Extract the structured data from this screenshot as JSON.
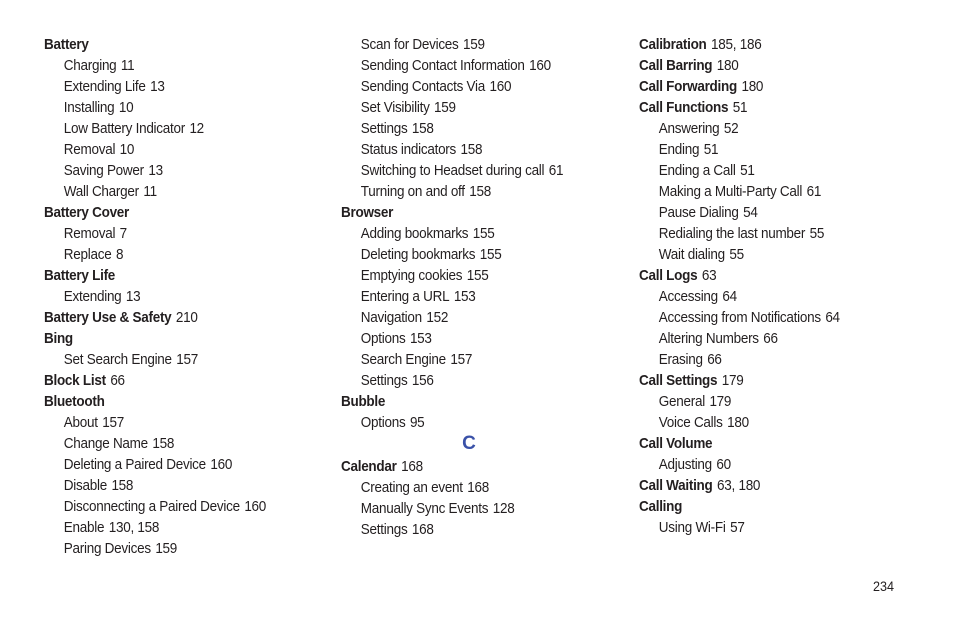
{
  "columns": [
    {
      "entries": [
        {
          "level": "main",
          "term": "Battery",
          "pages": ""
        },
        {
          "level": "sub",
          "term": "Charging",
          "pages": "11"
        },
        {
          "level": "sub",
          "term": "Extending Life",
          "pages": "13"
        },
        {
          "level": "sub",
          "term": "Installing",
          "pages": "10"
        },
        {
          "level": "sub",
          "term": "Low Battery Indicator",
          "pages": "12"
        },
        {
          "level": "sub",
          "term": "Removal",
          "pages": "10"
        },
        {
          "level": "sub",
          "term": "Saving Power",
          "pages": "13"
        },
        {
          "level": "sub",
          "term": "Wall Charger",
          "pages": "11"
        },
        {
          "level": "main",
          "term": "Battery Cover",
          "pages": ""
        },
        {
          "level": "sub",
          "term": "Removal",
          "pages": "7"
        },
        {
          "level": "sub",
          "term": "Replace",
          "pages": "8"
        },
        {
          "level": "main",
          "term": "Battery Life",
          "pages": ""
        },
        {
          "level": "sub",
          "term": "Extending",
          "pages": "13"
        },
        {
          "level": "main",
          "term": "Battery Use & Safety",
          "pages": "210"
        },
        {
          "level": "main",
          "term": "Bing",
          "pages": ""
        },
        {
          "level": "sub",
          "term": "Set Search Engine",
          "pages": "157"
        },
        {
          "level": "main",
          "term": "Block List",
          "pages": "66"
        },
        {
          "level": "main",
          "term": "Bluetooth",
          "pages": ""
        },
        {
          "level": "sub",
          "term": "About",
          "pages": "157"
        },
        {
          "level": "sub",
          "term": "Change Name",
          "pages": "158"
        },
        {
          "level": "sub",
          "term": "Deleting a Paired Device",
          "pages": "160"
        },
        {
          "level": "sub",
          "term": "Disable",
          "pages": "158"
        },
        {
          "level": "sub",
          "term": "Disconnecting a Paired Device",
          "pages": "160"
        },
        {
          "level": "sub",
          "term": "Enable",
          "pages": "130, 158"
        },
        {
          "level": "sub",
          "term": "Paring Devices",
          "pages": "159"
        }
      ]
    },
    {
      "entries": [
        {
          "level": "sub",
          "term": "Scan for Devices",
          "pages": "159"
        },
        {
          "level": "sub",
          "term": "Sending Contact Information",
          "pages": "160"
        },
        {
          "level": "sub",
          "term": "Sending Contacts Via",
          "pages": "160"
        },
        {
          "level": "sub",
          "term": "Set Visibility",
          "pages": "159"
        },
        {
          "level": "sub",
          "term": "Settings",
          "pages": "158"
        },
        {
          "level": "sub",
          "term": "Status indicators",
          "pages": "158"
        },
        {
          "level": "sub",
          "term": "Switching to Headset during call",
          "pages": "61"
        },
        {
          "level": "sub",
          "term": "Turning on and off",
          "pages": "158"
        },
        {
          "level": "main",
          "term": "Browser",
          "pages": ""
        },
        {
          "level": "sub",
          "term": "Adding bookmarks",
          "pages": "155"
        },
        {
          "level": "sub",
          "term": "Deleting bookmarks",
          "pages": "155"
        },
        {
          "level": "sub",
          "term": "Emptying cookies",
          "pages": "155"
        },
        {
          "level": "sub",
          "term": "Entering a URL",
          "pages": "153"
        },
        {
          "level": "sub",
          "term": "Navigation",
          "pages": "152"
        },
        {
          "level": "sub",
          "term": "Options",
          "pages": "153"
        },
        {
          "level": "sub",
          "term": "Search Engine",
          "pages": "157"
        },
        {
          "level": "sub",
          "term": "Settings",
          "pages": "156"
        },
        {
          "level": "main",
          "term": "Bubble",
          "pages": ""
        },
        {
          "level": "sub",
          "term": "Options",
          "pages": "95"
        },
        {
          "level": "letter",
          "term": "C",
          "pages": ""
        },
        {
          "level": "main",
          "term": "Calendar",
          "pages": "168"
        },
        {
          "level": "sub",
          "term": "Creating an event",
          "pages": "168"
        },
        {
          "level": "sub",
          "term": "Manually Sync Events",
          "pages": "128"
        },
        {
          "level": "sub",
          "term": "Settings",
          "pages": "168"
        }
      ]
    },
    {
      "entries": [
        {
          "level": "main",
          "term": "Calibration",
          "pages": "185, 186"
        },
        {
          "level": "main",
          "term": "Call Barring",
          "pages": "180"
        },
        {
          "level": "main",
          "term": "Call Forwarding",
          "pages": "180"
        },
        {
          "level": "main",
          "term": "Call Functions",
          "pages": "51"
        },
        {
          "level": "sub",
          "term": "Answering",
          "pages": "52"
        },
        {
          "level": "sub",
          "term": "Ending",
          "pages": "51"
        },
        {
          "level": "sub",
          "term": "Ending a Call",
          "pages": "51"
        },
        {
          "level": "sub",
          "term": "Making a Multi-Party Call",
          "pages": "61"
        },
        {
          "level": "sub",
          "term": "Pause Dialing",
          "pages": "54"
        },
        {
          "level": "sub",
          "term": "Redialing the last number",
          "pages": "55"
        },
        {
          "level": "sub",
          "term": "Wait dialing",
          "pages": "55"
        },
        {
          "level": "main",
          "term": "Call Logs",
          "pages": "63"
        },
        {
          "level": "sub",
          "term": "Accessing",
          "pages": "64"
        },
        {
          "level": "sub",
          "term": "Accessing from Notifications",
          "pages": "64"
        },
        {
          "level": "sub",
          "term": "Altering Numbers",
          "pages": "66"
        },
        {
          "level": "sub",
          "term": "Erasing",
          "pages": "66"
        },
        {
          "level": "main",
          "term": "Call Settings",
          "pages": "179"
        },
        {
          "level": "sub",
          "term": "General",
          "pages": "179"
        },
        {
          "level": "sub",
          "term": "Voice Calls",
          "pages": "180"
        },
        {
          "level": "main",
          "term": "Call Volume",
          "pages": ""
        },
        {
          "level": "sub",
          "term": "Adjusting",
          "pages": "60"
        },
        {
          "level": "main",
          "term": "Call Waiting",
          "pages": "63, 180"
        },
        {
          "level": "main",
          "term": "Calling",
          "pages": ""
        },
        {
          "level": "sub",
          "term": "Using Wi-Fi",
          "pages": "57"
        }
      ]
    }
  ],
  "footer": {
    "page_number": "234"
  },
  "colors": {
    "text": "#231f20",
    "section_letter": "#3a51a8"
  }
}
